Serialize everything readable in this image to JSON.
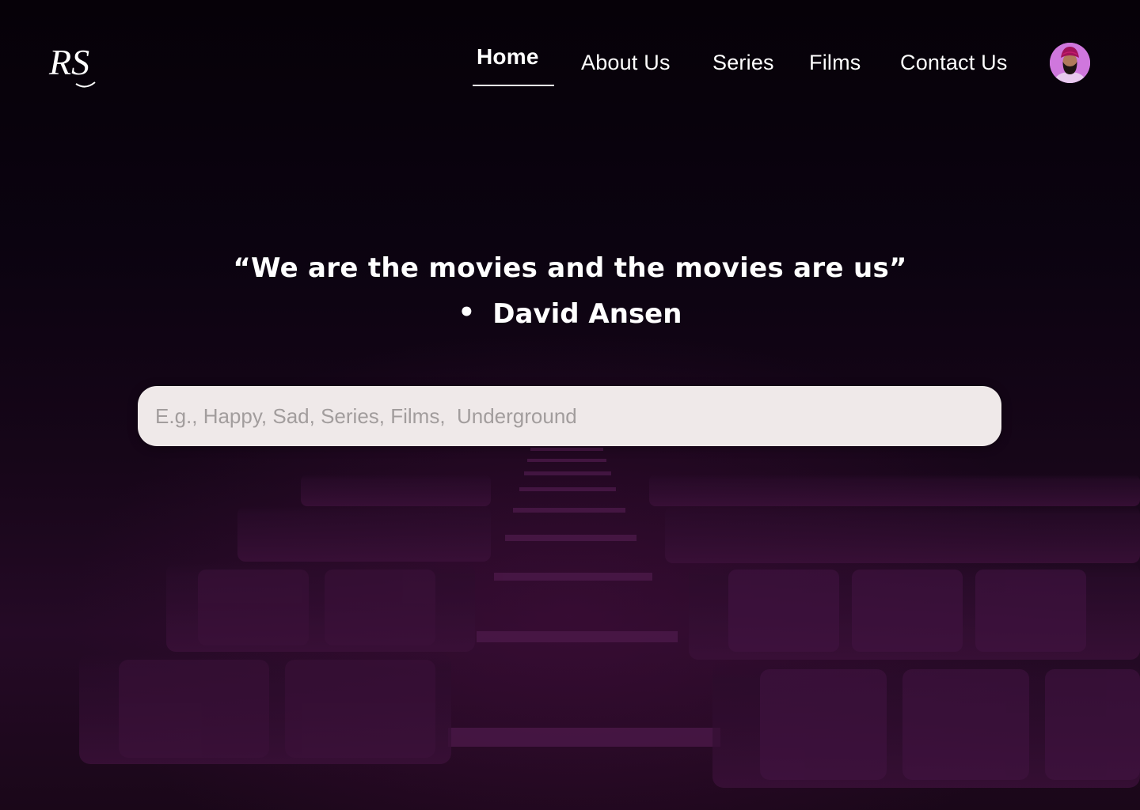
{
  "header": {
    "logo_text": "RS",
    "nav": [
      {
        "label": "Home",
        "active": true
      },
      {
        "label": "About Us",
        "active": false
      },
      {
        "label": "Series",
        "active": false
      },
      {
        "label": "Films",
        "active": false
      },
      {
        "label": "Contact Us",
        "active": false
      }
    ],
    "avatar_icon": "user-avatar"
  },
  "hero": {
    "quote": "“We are the movies and the movies are us”",
    "bullet": "•",
    "author": "David Ansen"
  },
  "search": {
    "value": "",
    "placeholder": "E.g., Happy, Sad, Series, Films,  Underground"
  },
  "colors": {
    "background_top": "#060108",
    "background_bottom": "#250a26",
    "search_bg": "#efe9e9",
    "placeholder": "#a29d9d",
    "text": "#ffffff"
  }
}
